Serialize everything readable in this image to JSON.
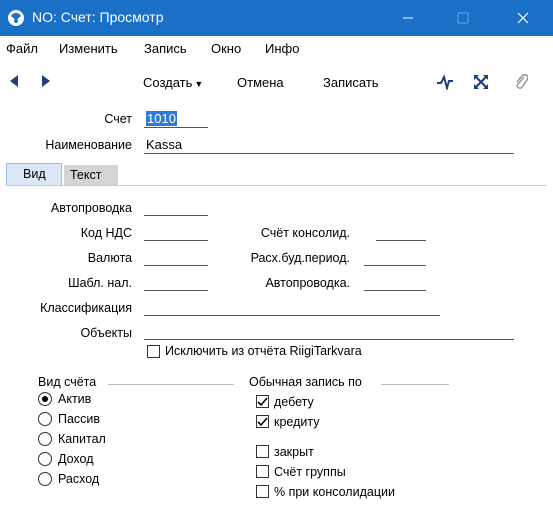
{
  "window": {
    "title": "NO: Счет: Просмотр",
    "title_bg": "#1a6fc6"
  },
  "menu": {
    "items": [
      "Файл",
      "Изменить",
      "Запись",
      "Окно",
      "Инфо"
    ]
  },
  "toolbar": {
    "create_label": "Создать",
    "cancel_label": "Отмена",
    "save_label": "Записать"
  },
  "form": {
    "account_label": "Счет",
    "account_value": "1010",
    "name_label": "Наименование",
    "name_value": "Kassa"
  },
  "tabs": [
    {
      "label": "Вид",
      "active": true
    },
    {
      "label": "Текст",
      "active": false
    }
  ],
  "view": {
    "autopost_label": "Автопроводка",
    "autopost_value": "",
    "vat_code_label": "Код НДС",
    "vat_code_value": "",
    "consol_account_label": "Счёт консолид.",
    "consol_account_value": "",
    "currency_label": "Валюта",
    "currency_value": "",
    "budget_period_label": "Расх.буд.период.",
    "budget_period_value": "",
    "tax_template_label": "Шабл. нал.",
    "tax_template_value": "",
    "autopost2_label": "Автопроводка.",
    "autopost2_value": "",
    "classification_label": "Классификация",
    "classification_value": "",
    "objects_label": "Объекты",
    "objects_value": "",
    "exclude_label": "Исключить из отчёта RiigiTarkvara",
    "exclude_checked": false
  },
  "account_type": {
    "title": "Вид счёта",
    "options": [
      {
        "label": "Актив",
        "selected": true
      },
      {
        "label": "Пассив",
        "selected": false
      },
      {
        "label": "Капитал",
        "selected": false
      },
      {
        "label": "Доход",
        "selected": false
      },
      {
        "label": "Расход",
        "selected": false
      }
    ]
  },
  "normal_entry": {
    "title": "Обычная запись по",
    "debit_label": "дебету",
    "debit_checked": true,
    "credit_label": "кредиту",
    "credit_checked": true
  },
  "flags": {
    "closed_label": "закрыт",
    "closed_checked": false,
    "group_label": "Счёт группы",
    "group_checked": false,
    "consol_pct_label": "% при консолидации",
    "consol_pct_checked": false
  }
}
